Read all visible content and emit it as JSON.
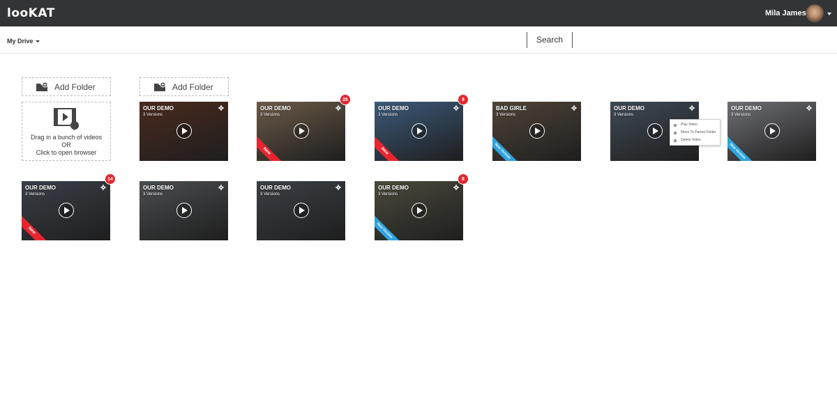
{
  "app": {
    "logo": "looKAT"
  },
  "user": {
    "name": "Mila James"
  },
  "subbar": {
    "drive_label": "My Drive",
    "search_label": "Search"
  },
  "actions": {
    "add_folder_label": "Add Folder"
  },
  "dropzone": {
    "line1": "Drag in a bunch of videos",
    "line2": "OR",
    "line3": "Click to open browser"
  },
  "tiles": [
    {
      "title": "OUR DEMO",
      "versions": "3 Versions",
      "badge": "",
      "ribbon": "",
      "bg": "#4a2a1e"
    },
    {
      "title": "OUR DEMO",
      "versions": "3 Versions",
      "badge": "26",
      "ribbon": "New",
      "bg": "#6b5a48"
    },
    {
      "title": "OUR DEMO",
      "versions": "3 Versions",
      "badge": "8",
      "ribbon": "New",
      "bg": "#3c5a7a"
    },
    {
      "title": "BAD GIRLE",
      "versions": "3 Versions",
      "badge": "",
      "ribbon": "New Version",
      "bg": "#4f4438"
    },
    {
      "title": "OUR DEMO",
      "versions": "3 Versions",
      "badge": "",
      "ribbon": "",
      "bg": "#3f4a55"
    },
    {
      "title": "OUR DEMO",
      "versions": "3 Versions",
      "badge": "",
      "ribbon": "New Version",
      "bg": "#6f7074"
    },
    {
      "title": "OUR DEMO",
      "versions": "3 Versions",
      "badge": "14",
      "ribbon": "New",
      "bg": "#3a3f48"
    },
    {
      "title": "OUR DEMO",
      "versions": "3 Versions",
      "badge": "",
      "ribbon": "",
      "bg": "#4a4d4f"
    },
    {
      "title": "OUR DEMO",
      "versions": "3 Versions",
      "badge": "",
      "ribbon": "",
      "bg": "#3b4046"
    },
    {
      "title": "OUR DEMO",
      "versions": "3 Versions",
      "badge": "8",
      "ribbon": "New Version",
      "bg": "#4a4a3c"
    }
  ],
  "context_menu": {
    "items": [
      "Play Video",
      "Move To Parent Folder",
      "Delete Video"
    ]
  },
  "colors": {
    "topbar": "#333436",
    "badge": "#e3262e",
    "ribbon_new": "#e8252f",
    "ribbon_new_version": "#2ea4de"
  }
}
